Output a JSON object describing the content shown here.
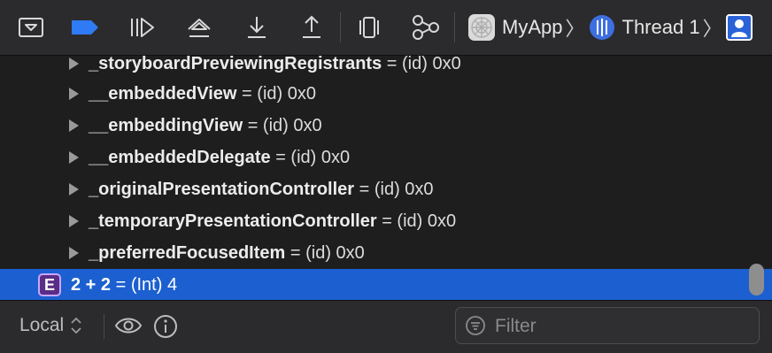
{
  "toolbar": {
    "icons": [
      "hide-debug-area-icon",
      "breakpoints-toggle-icon",
      "continue-icon",
      "step-over-icon",
      "step-into-icon",
      "step-out-icon",
      "view-hierarchy-icon",
      "memory-graph-icon"
    ],
    "breadcrumb": {
      "target": "MyApp",
      "thread": "Thread 1",
      "chevron": "〉"
    }
  },
  "variables": [
    {
      "name": "_storyboardPreviewingRegistrants",
      "value": " = (id) 0x0"
    },
    {
      "name": "__embeddedView",
      "value": " = (id) 0x0"
    },
    {
      "name": "__embeddingView",
      "value": " = (id) 0x0"
    },
    {
      "name": "__embeddedDelegate",
      "value": " = (id) 0x0"
    },
    {
      "name": "_originalPresentationController",
      "value": " = (id) 0x0"
    },
    {
      "name": "_temporaryPresentationController",
      "value": " = (id) 0x0"
    },
    {
      "name": "_preferredFocusedItem",
      "value": " = (id) 0x0"
    }
  ],
  "expression": {
    "badge": "E",
    "name": "2 + 2",
    "value": " = (Int) 4"
  },
  "bottombar": {
    "scope": "Local",
    "scope_chevron": "⌃",
    "filter_placeholder": "Filter"
  },
  "colors": {
    "selection": "#1c5fd0",
    "breakpoint_active": "#2f7bf6",
    "expression_badge": "#5a2d86"
  }
}
